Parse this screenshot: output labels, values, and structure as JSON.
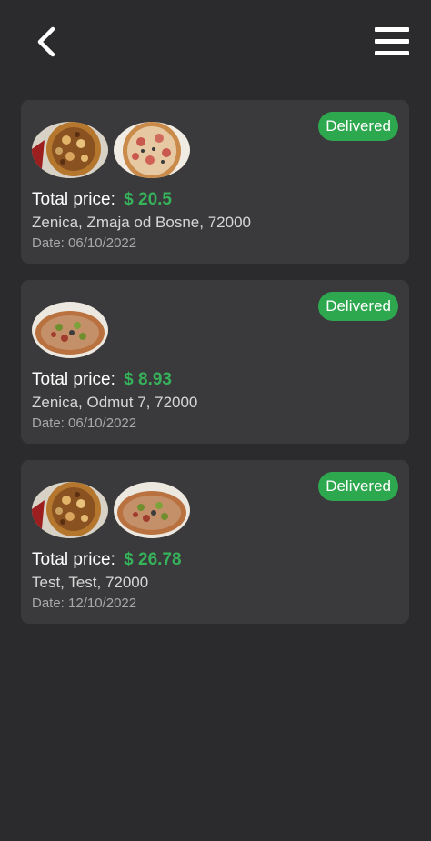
{
  "header": {
    "back_icon": "chevron-left-icon",
    "menu_icon": "hamburger-menu-icon"
  },
  "orders": [
    {
      "items": [
        "bbq-chicken-pizza",
        "ham-pizza"
      ],
      "status": "Delivered",
      "price_label": "Total price:",
      "price": "$ 20.5",
      "address": "Zenica, Zmaja od Bosne, 72000",
      "date": "Date: 06/10/2022"
    },
    {
      "items": [
        "veggie-pizza"
      ],
      "status": "Delivered",
      "price_label": "Total price:",
      "price": "$ 8.93",
      "address": "Zenica, Odmut 7, 72000",
      "date": "Date: 06/10/2022"
    },
    {
      "items": [
        "bbq-chicken-pizza",
        "veggie-pizza"
      ],
      "status": "Delivered",
      "price_label": "Total price:",
      "price": "$ 26.78",
      "address": "Test, Test, 72000",
      "date": "Date: 12/10/2022"
    }
  ],
  "colors": {
    "background": "#2b2b2d",
    "card": "#3a3a3c",
    "status_green": "#2ea84f",
    "price_green": "#35b25a"
  }
}
